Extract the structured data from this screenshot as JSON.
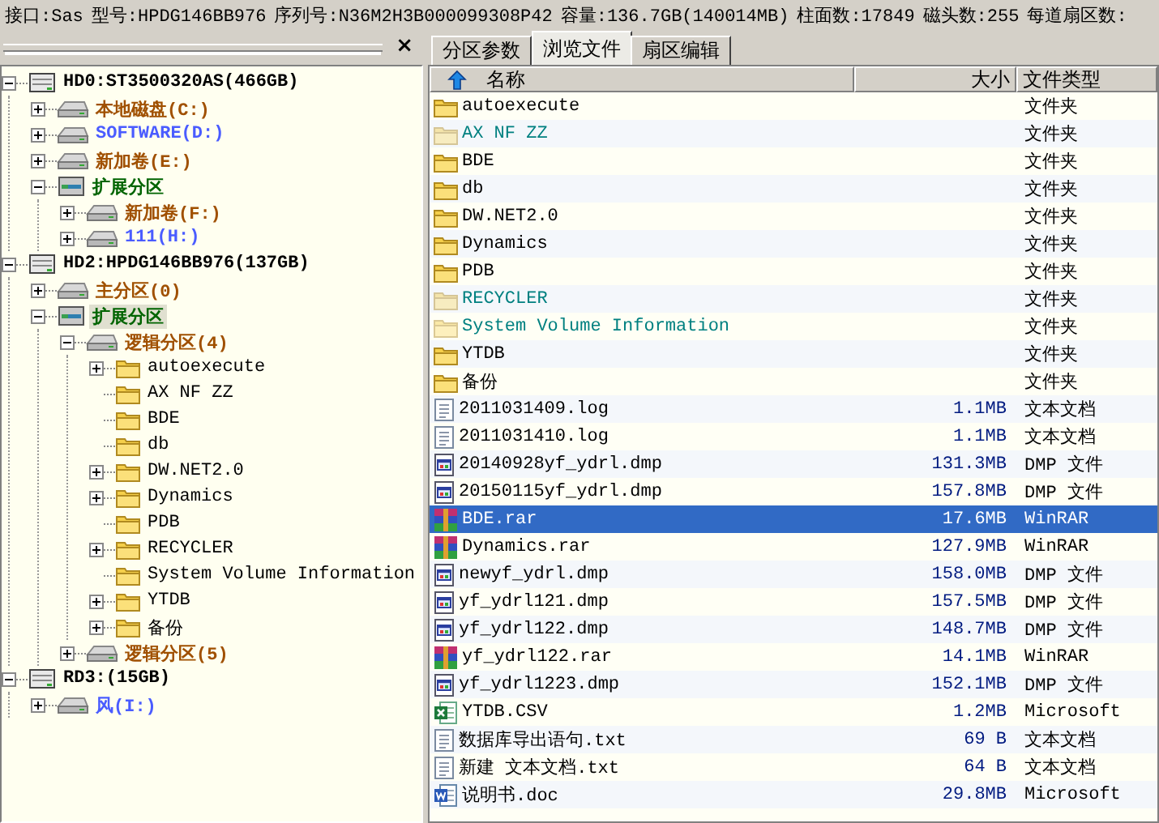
{
  "info_bar": [
    "接口:Sas",
    "型号:HPDG146BB976",
    "序列号:N36M2H3B000099308P42",
    "容量:136.7GB(140014MB)",
    "柱面数:17849",
    "磁头数:255",
    "每道扇区数:"
  ],
  "tree_pane": {
    "close": "×",
    "nodes": [
      {
        "label": "HD0:ST3500320AS(466GB)",
        "kind": "disk",
        "expandable": true,
        "expanded": true,
        "selected": false,
        "color": "#000000",
        "children": [
          {
            "label": "本地磁盘(C:)",
            "kind": "partition",
            "expandable": true,
            "expanded": false,
            "selected": false,
            "color": "#a05000"
          },
          {
            "label": "SOFTWARE(D:)",
            "kind": "partition",
            "expandable": true,
            "expanded": false,
            "selected": false,
            "color": "#4a5cff"
          },
          {
            "label": "新加卷(E:)",
            "kind": "partition",
            "expandable": true,
            "expanded": false,
            "selected": false,
            "color": "#a05000"
          },
          {
            "label": "扩展分区",
            "kind": "extended",
            "expandable": true,
            "expanded": true,
            "selected": false,
            "color": "#006400",
            "children": [
              {
                "label": "新加卷(F:)",
                "kind": "partition",
                "expandable": true,
                "expanded": false,
                "selected": false,
                "color": "#a05000"
              },
              {
                "label": "111(H:)",
                "kind": "partition",
                "expandable": true,
                "expanded": false,
                "selected": false,
                "color": "#4a5cff"
              }
            ]
          }
        ]
      },
      {
        "label": "HD2:HPDG146BB976(137GB)",
        "kind": "disk",
        "expandable": true,
        "expanded": true,
        "selected": false,
        "color": "#000000",
        "children": [
          {
            "label": "主分区(0)",
            "kind": "partition",
            "expandable": true,
            "expanded": false,
            "selected": false,
            "color": "#a05000"
          },
          {
            "label": "扩展分区",
            "kind": "extended",
            "expandable": true,
            "expanded": true,
            "selected": true,
            "color": "#006400",
            "children": [
              {
                "label": "逻辑分区(4)",
                "kind": "partition",
                "expandable": true,
                "expanded": true,
                "selected": false,
                "color": "#a05000",
                "children": [
                  {
                    "label": "autoexecute",
                    "kind": "folder",
                    "expandable": true,
                    "expanded": false,
                    "selected": false,
                    "color": "#000000"
                  },
                  {
                    "label": "AX NF ZZ",
                    "kind": "folder",
                    "expandable": false,
                    "selected": false,
                    "color": "#000000"
                  },
                  {
                    "label": "BDE",
                    "kind": "folder",
                    "expandable": false,
                    "selected": false,
                    "color": "#000000"
                  },
                  {
                    "label": "db",
                    "kind": "folder",
                    "expandable": false,
                    "selected": false,
                    "color": "#000000"
                  },
                  {
                    "label": "DW.NET2.0",
                    "kind": "folder",
                    "expandable": true,
                    "expanded": false,
                    "selected": false,
                    "color": "#000000"
                  },
                  {
                    "label": "Dynamics",
                    "kind": "folder",
                    "expandable": true,
                    "expanded": false,
                    "selected": false,
                    "color": "#000000"
                  },
                  {
                    "label": "PDB",
                    "kind": "folder",
                    "expandable": false,
                    "selected": false,
                    "color": "#000000"
                  },
                  {
                    "label": "RECYCLER",
                    "kind": "folder",
                    "expandable": true,
                    "expanded": false,
                    "selected": false,
                    "color": "#000000"
                  },
                  {
                    "label": "System Volume Information",
                    "kind": "folder",
                    "expandable": false,
                    "selected": false,
                    "color": "#000000"
                  },
                  {
                    "label": "YTDB",
                    "kind": "folder",
                    "expandable": true,
                    "expanded": false,
                    "selected": false,
                    "color": "#000000"
                  },
                  {
                    "label": "备份",
                    "kind": "folder",
                    "expandable": true,
                    "expanded": false,
                    "selected": false,
                    "color": "#000000"
                  }
                ]
              },
              {
                "label": "逻辑分区(5)",
                "kind": "partition",
                "expandable": true,
                "expanded": false,
                "selected": false,
                "color": "#a05000"
              }
            ]
          }
        ]
      },
      {
        "label": "RD3:(15GB)",
        "kind": "disk",
        "expandable": true,
        "expanded": true,
        "selected": false,
        "color": "#000000",
        "children": [
          {
            "label": "风(I:)",
            "kind": "partition",
            "expandable": true,
            "expanded": false,
            "selected": false,
            "color": "#4a5cff"
          }
        ]
      }
    ]
  },
  "tabs": [
    {
      "label": "分区参数",
      "selected": false
    },
    {
      "label": "浏览文件",
      "selected": true
    },
    {
      "label": "扇区编辑",
      "selected": false
    }
  ],
  "file_table": {
    "columns": [
      "名称",
      "大小",
      "文件类型"
    ],
    "rows": [
      {
        "name": "autoexecute",
        "kind": "folder",
        "hidden": false,
        "selected": false,
        "type": "文件夹"
      },
      {
        "name": "AX NF ZZ",
        "kind": "folder",
        "hidden": true,
        "selected": false,
        "type": "文件夹"
      },
      {
        "name": "BDE",
        "kind": "folder",
        "hidden": false,
        "selected": false,
        "type": "文件夹"
      },
      {
        "name": "db",
        "kind": "folder",
        "hidden": false,
        "selected": false,
        "type": "文件夹"
      },
      {
        "name": "DW.NET2.0",
        "kind": "folder",
        "hidden": false,
        "selected": false,
        "type": "文件夹"
      },
      {
        "name": "Dynamics",
        "kind": "folder",
        "hidden": false,
        "selected": false,
        "type": "文件夹"
      },
      {
        "name": "PDB",
        "kind": "folder",
        "hidden": false,
        "selected": false,
        "type": "文件夹"
      },
      {
        "name": "RECYCLER",
        "kind": "folder",
        "hidden": true,
        "selected": false,
        "type": "文件夹"
      },
      {
        "name": "System Volume Information",
        "kind": "folder",
        "hidden": true,
        "selected": false,
        "type": "文件夹"
      },
      {
        "name": "YTDB",
        "kind": "folder",
        "hidden": false,
        "selected": false,
        "type": "文件夹"
      },
      {
        "name": "备份",
        "kind": "folder",
        "hidden": false,
        "selected": false,
        "type": "文件夹"
      },
      {
        "name": "2011031409.log",
        "kind": "text",
        "hidden": false,
        "selected": false,
        "size": "1.1MB",
        "type": "文本文档"
      },
      {
        "name": "2011031410.log",
        "kind": "text",
        "hidden": false,
        "selected": false,
        "size": "1.1MB",
        "type": "文本文档"
      },
      {
        "name": "20140928yf_ydrl.dmp",
        "kind": "dmp",
        "hidden": false,
        "selected": false,
        "size": "131.3MB",
        "type": "DMP 文件"
      },
      {
        "name": "20150115yf_ydrl.dmp",
        "kind": "dmp",
        "hidden": false,
        "selected": false,
        "size": "157.8MB",
        "type": "DMP 文件"
      },
      {
        "name": "BDE.rar",
        "kind": "rar",
        "hidden": false,
        "selected": true,
        "size": "17.6MB",
        "type": "WinRAR"
      },
      {
        "name": "Dynamics.rar",
        "kind": "rar",
        "hidden": false,
        "selected": false,
        "size": "127.9MB",
        "type": "WinRAR"
      },
      {
        "name": "newyf_ydrl.dmp",
        "kind": "dmp",
        "hidden": false,
        "selected": false,
        "size": "158.0MB",
        "type": "DMP 文件"
      },
      {
        "name": "yf_ydrl121.dmp",
        "kind": "dmp",
        "hidden": false,
        "selected": false,
        "size": "157.5MB",
        "type": "DMP 文件"
      },
      {
        "name": "yf_ydrl122.dmp",
        "kind": "dmp",
        "hidden": false,
        "selected": false,
        "size": "148.7MB",
        "type": "DMP 文件"
      },
      {
        "name": "yf_ydrl122.rar",
        "kind": "rar",
        "hidden": false,
        "selected": false,
        "size": "14.1MB",
        "type": "WinRAR"
      },
      {
        "name": "yf_ydrl1223.dmp",
        "kind": "dmp",
        "hidden": false,
        "selected": false,
        "size": "152.1MB",
        "type": "DMP 文件"
      },
      {
        "name": "YTDB.CSV",
        "kind": "excel",
        "hidden": false,
        "selected": false,
        "size": "1.2MB",
        "type": "Microsoft"
      },
      {
        "name": "数据库导出语句.txt",
        "kind": "text",
        "hidden": false,
        "selected": false,
        "size": "69 B",
        "type": "文本文档"
      },
      {
        "name": "新建 文本文档.txt",
        "kind": "text",
        "hidden": false,
        "selected": false,
        "size": "64 B",
        "type": "文本文档"
      },
      {
        "name": "说明书.doc",
        "kind": "word",
        "hidden": false,
        "selected": false,
        "size": "29.8MB",
        "type": "Microsoft"
      }
    ]
  }
}
